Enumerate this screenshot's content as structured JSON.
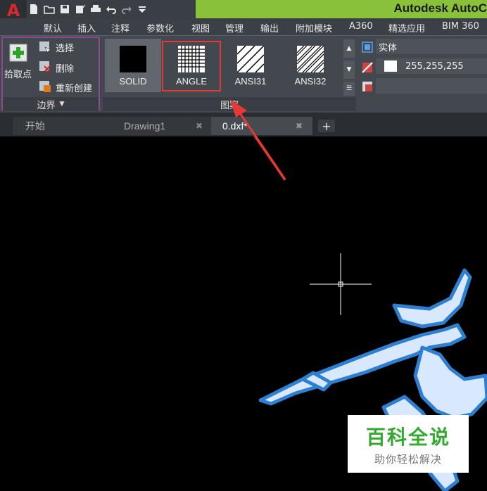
{
  "app": {
    "title": "Autodesk AutoC",
    "logo": "A"
  },
  "quick_access": [
    "new-icon",
    "open-icon",
    "save-icon",
    "saveas-icon",
    "print-icon",
    "undo-icon",
    "redo-icon",
    "dropdown-icon"
  ],
  "ribbon_tabs": [
    "默认",
    "插入",
    "注释",
    "参数化",
    "视图",
    "管理",
    "输出",
    "附加模块",
    "A360",
    "精选应用",
    "BIM 360"
  ],
  "boundary_panel": {
    "pick_point_label": "拾取点",
    "select_label": "选择",
    "delete_label": "删除",
    "recreate_label": "重新创建",
    "footer_label": "边界"
  },
  "pattern_panel": {
    "patterns": [
      "SOLID",
      "ANGLE",
      "ANSI31",
      "ANSI32"
    ],
    "selected": "ANGLE",
    "footer_label": "图案"
  },
  "properties_panel": {
    "type_value": "实体",
    "color_value": "255,255,255"
  },
  "document_tabs": [
    {
      "label": "开始"
    },
    {
      "label": "Drawing1"
    },
    {
      "label": "0.dxf*"
    }
  ],
  "watermark": {
    "title": "百科全说",
    "subtitle": "助你轻松解决"
  },
  "colors": {
    "accent_green": "#89c23a",
    "selection_red": "#e03c3c",
    "hatch_blue": "#2f7fd1"
  }
}
